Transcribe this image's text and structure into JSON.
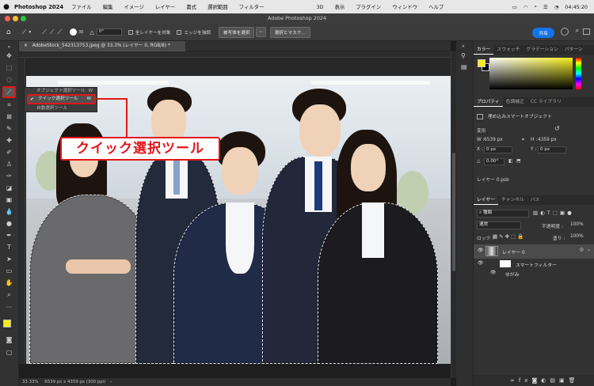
{
  "menubar": {
    "app_name": "Photoshop 2024",
    "items": [
      "ファイル",
      "編集",
      "イメージ",
      "レイヤー",
      "書式",
      "選択範囲",
      "フィルター",
      "3D",
      "表示",
      "プラグイン",
      "ウィンドウ",
      "ヘルプ"
    ],
    "time": "04:45:20"
  },
  "window": {
    "title": "Adobe Photoshop 2024"
  },
  "options_bar": {
    "brush_size": "30",
    "angle": "0°",
    "sample_all_label": "全レイヤーを対象",
    "enhance_edge_label": "エッジを強調",
    "select_subject_label": "被写体を選択",
    "select_mask_label": "選択とマスク...",
    "share_label": "共有"
  },
  "document_tab": {
    "label": "AdobeStock_542313753.jpeg @ 33.3% (レイヤー 0, RGB/8) *"
  },
  "tool_flyout": {
    "item_above": "オブジェクト選択ツール",
    "item_above_key": "W",
    "selected_item": "クイック選択ツール",
    "selected_key": "W",
    "item_below": "自動選択ツール"
  },
  "callout": {
    "text": "クイック選択ツール"
  },
  "status_bar": {
    "zoom": "33.33%",
    "doc_info": "6539 px x 4359 px (300 ppi)"
  },
  "color_panel": {
    "tabs": [
      "カラー",
      "スウォッチ",
      "グラデーション",
      "パターン"
    ],
    "foreground": "#f4ee18",
    "background": "#000000"
  },
  "properties_panel": {
    "tabs": [
      "プロパティ",
      "色調補正",
      "CC ライブラリ"
    ],
    "object_type": "埋め込みスマートオブジェクト",
    "transform_label": "変形",
    "w_label": "W :",
    "w_value": "6539 px",
    "h_label": "H :",
    "h_value": "4359 px",
    "x_label": "X :",
    "x_value": "0 px",
    "y_label": "Y :",
    "y_value": "0 px",
    "angle_value": "0.00°",
    "linked_file": "レイヤー 0.psb"
  },
  "layers_panel": {
    "tabs": [
      "レイヤー",
      "チャンネル",
      "パス"
    ],
    "filter_kind": "種類",
    "blend_mode": "通常",
    "opacity_label": "不透明度 :",
    "opacity_value": "100%",
    "lock_label": "ロック :",
    "fill_label": "塗り :",
    "fill_value": "100%",
    "layers": [
      {
        "name": "レイヤー 0"
      },
      {
        "name": "スマートフィルター"
      },
      {
        "name": "ゆがみ"
      }
    ]
  }
}
